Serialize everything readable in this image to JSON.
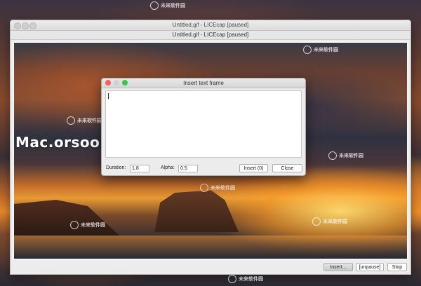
{
  "main_window": {
    "title": "Untitled.gif - LICEcap [paused]",
    "subtitle": "Untitled.gif - LICEcap [paused]",
    "buttons": {
      "insert": "Insert...",
      "unpause": "[unpause]",
      "stop": "Stop"
    }
  },
  "dialog": {
    "title": "Insert text frame",
    "text_value": "",
    "duration_label": "Duration:",
    "duration_value": "1.8",
    "alpha_label": "Alpha:",
    "alpha_value": "0.5",
    "insert_button": "Insert (0)",
    "close_button": "Close"
  },
  "watermarks": {
    "site": "Mac.orsoon.com",
    "brand": "未来软件园",
    "url": "mac.orsoon.com"
  },
  "colors": {
    "close": "#fc605c",
    "minimize": "#fdbc40",
    "zoom": "#34c84a"
  }
}
